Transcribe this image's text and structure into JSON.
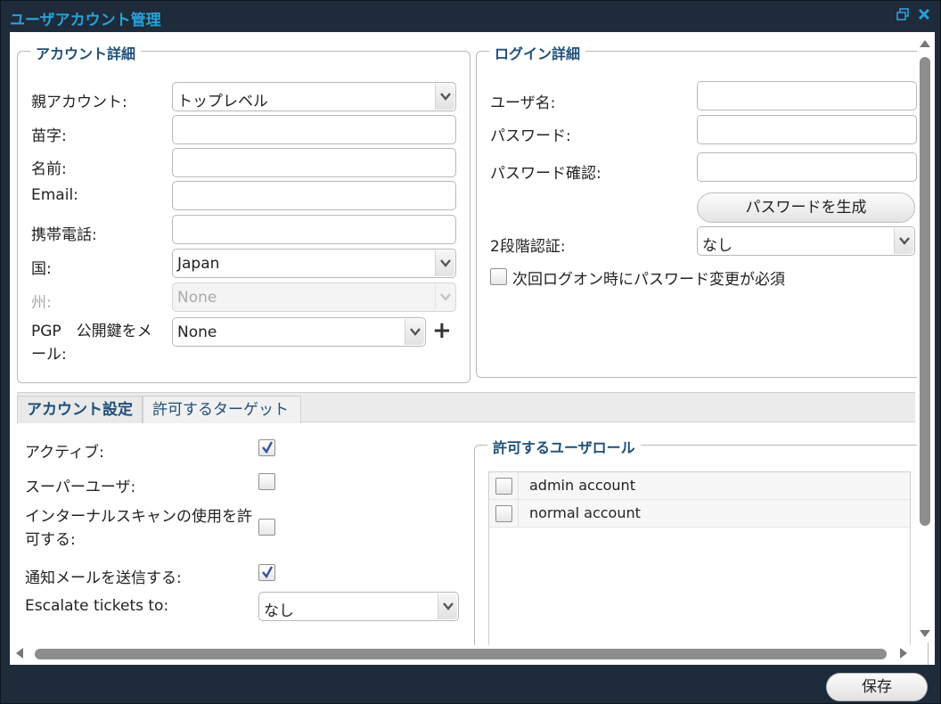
{
  "window": {
    "title": "ユーザアカウント管理",
    "restore_icon": "restore-icon",
    "close_icon": "close-icon"
  },
  "account_details": {
    "legend": "アカウント詳細",
    "parent_account": {
      "label": "親アカウント:",
      "value": "トップレベル"
    },
    "last_name": {
      "label": "苗字:",
      "value": ""
    },
    "first_name": {
      "label": "名前:",
      "value": ""
    },
    "email": {
      "label": "Email:",
      "value": ""
    },
    "mobile": {
      "label": "携帯電話:",
      "value": ""
    },
    "country": {
      "label": "国:",
      "value": "Japan"
    },
    "state": {
      "label": "州:",
      "value": "None",
      "disabled": true
    },
    "pgp": {
      "label": "PGP　公開鍵をメール:",
      "value": "None",
      "add_icon": "plus-icon"
    }
  },
  "login_details": {
    "legend": "ログイン詳細",
    "username": {
      "label": "ユーザ名:",
      "value": ""
    },
    "password": {
      "label": "パスワード:",
      "value": ""
    },
    "password_confirm": {
      "label": "パスワード確認:",
      "value": ""
    },
    "generate_button": "パスワードを生成",
    "two_factor": {
      "label": "2段階認証:",
      "value": "なし"
    },
    "change_password_next_logon": {
      "label": "次回ログオン時にパスワード変更が必須",
      "checked": false
    }
  },
  "tabs": [
    {
      "label": "アカウント設定",
      "active": true
    },
    {
      "label": "許可するターゲット",
      "active": false
    }
  ],
  "account_settings": {
    "active": {
      "label": "アクティブ:",
      "checked": true
    },
    "superuser": {
      "label": "スーパーユーザ:",
      "checked": false
    },
    "internal_scan": {
      "label": "インターナルスキャンの使用を許可する:",
      "checked": false
    },
    "send_notification": {
      "label": "通知メールを送信する:",
      "checked": true
    },
    "escalate": {
      "label": "Escalate tickets to:",
      "value": "なし"
    }
  },
  "user_roles": {
    "legend": "許可するユーザロール",
    "roles": [
      {
        "name": "admin account",
        "checked": false
      },
      {
        "name": "normal account",
        "checked": false
      }
    ]
  },
  "footer": {
    "save_label": "保存"
  },
  "colors": {
    "title": "#2a9fd8",
    "legend": "#1f4f7a",
    "frame": "#1e2b3a"
  }
}
